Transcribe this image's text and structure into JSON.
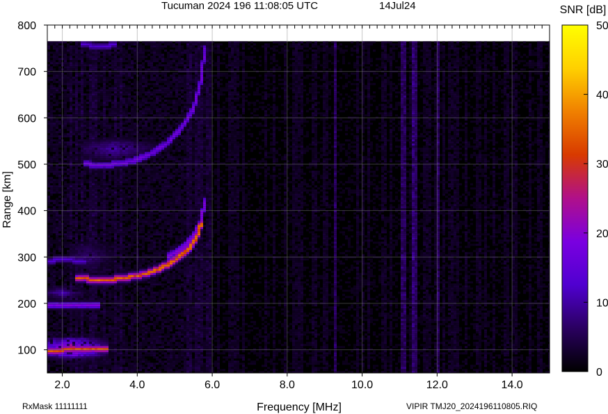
{
  "chart_data": {
    "type": "heatmap",
    "title": "Tucuman 2024 196 11:08:05 UTC",
    "date": "14Jul24",
    "xlabel": "Frequency [MHz]",
    "ylabel": "Range [km]",
    "xlim": [
      1.6,
      15.0
    ],
    "ylim": [
      50,
      800
    ],
    "data_top_km": 765,
    "x_ticks": [
      2.0,
      4.0,
      6.0,
      8.0,
      10.0,
      12.0,
      14.0
    ],
    "x_tick_labels": [
      "2.0",
      "4.0",
      "6.0",
      "8.0",
      "10.0",
      "12.0",
      "14.0"
    ],
    "y_ticks": [
      100,
      200,
      300,
      400,
      500,
      600,
      700,
      800
    ],
    "y_tick_labels": [
      "100",
      "200",
      "300",
      "400",
      "500",
      "600",
      "700",
      "800"
    ],
    "colorbar": {
      "label": "SNR [dB]",
      "range": [
        0,
        50
      ],
      "ticks": [
        0,
        10,
        20,
        30,
        40,
        50
      ],
      "tick_labels": [
        "0",
        "10",
        "20",
        "30",
        "40",
        "50"
      ],
      "colors": [
        "#000000",
        "#2a0060",
        "#5000d0",
        "#7a00e0",
        "#b0108a",
        "#d83a00",
        "#f08000",
        "#ffd000",
        "#ffff00"
      ]
    },
    "grid": true,
    "traces": [
      {
        "name": "E-layer O",
        "points": [
          [
            1.6,
            98
          ],
          [
            2.0,
            99
          ],
          [
            2.6,
            100
          ],
          [
            3.0,
            100
          ],
          [
            3.2,
            101
          ]
        ],
        "peak_snr": 32
      },
      {
        "name": "E-layer echo",
        "points": [
          [
            1.6,
            196
          ],
          [
            2.2,
            197
          ],
          [
            2.8,
            197
          ],
          [
            3.0,
            198
          ]
        ],
        "peak_snr": 18
      },
      {
        "name": "F-layer O",
        "points": [
          [
            2.4,
            254
          ],
          [
            3.0,
            250
          ],
          [
            3.6,
            253
          ],
          [
            4.2,
            263
          ],
          [
            4.6,
            275
          ],
          [
            5.0,
            292
          ],
          [
            5.4,
            320
          ],
          [
            5.6,
            345
          ],
          [
            5.7,
            372
          ]
        ],
        "peak_snr": 33
      },
      {
        "name": "F-layer X",
        "points": [
          [
            4.8,
            300
          ],
          [
            5.2,
            318
          ],
          [
            5.5,
            345
          ],
          [
            5.7,
            375
          ],
          [
            5.8,
            420
          ]
        ],
        "peak_snr": 18
      },
      {
        "name": "F-layer 2nd hop",
        "points": [
          [
            2.6,
            500
          ],
          [
            3.2,
            498
          ],
          [
            3.8,
            505
          ],
          [
            4.3,
            520
          ],
          [
            4.8,
            545
          ],
          [
            5.2,
            580
          ],
          [
            5.5,
            620
          ],
          [
            5.7,
            680
          ],
          [
            5.8,
            750
          ]
        ],
        "peak_snr": 16
      },
      {
        "name": "E-layer 2nd hop",
        "points": [
          [
            1.6,
            292
          ],
          [
            2.0,
            293
          ],
          [
            2.6,
            292
          ]
        ],
        "peak_snr": 12
      },
      {
        "name": "F-layer 3rd hop",
        "points": [
          [
            2.5,
            760
          ],
          [
            3.0,
            752
          ],
          [
            3.4,
            758
          ]
        ],
        "peak_snr": 12
      }
    ],
    "blobs": [
      {
        "f0": 1.6,
        "f1": 3.2,
        "r0": 78,
        "r1": 128,
        "snr": 28
      },
      {
        "f0": 1.6,
        "f1": 2.6,
        "r0": 205,
        "r1": 240,
        "snr": 12
      },
      {
        "f0": 2.2,
        "f1": 3.4,
        "r0": 260,
        "r1": 340,
        "snr": 8
      },
      {
        "f0": 2.6,
        "f1": 4.6,
        "r0": 505,
        "r1": 560,
        "snr": 11
      }
    ],
    "bright_columns": [
      9.3,
      11.1,
      11.4,
      12.0
    ]
  },
  "footer": {
    "rxmask": "RxMask 11111111",
    "file": "VIPIR  TMJ20_2024196110805.RIQ"
  }
}
